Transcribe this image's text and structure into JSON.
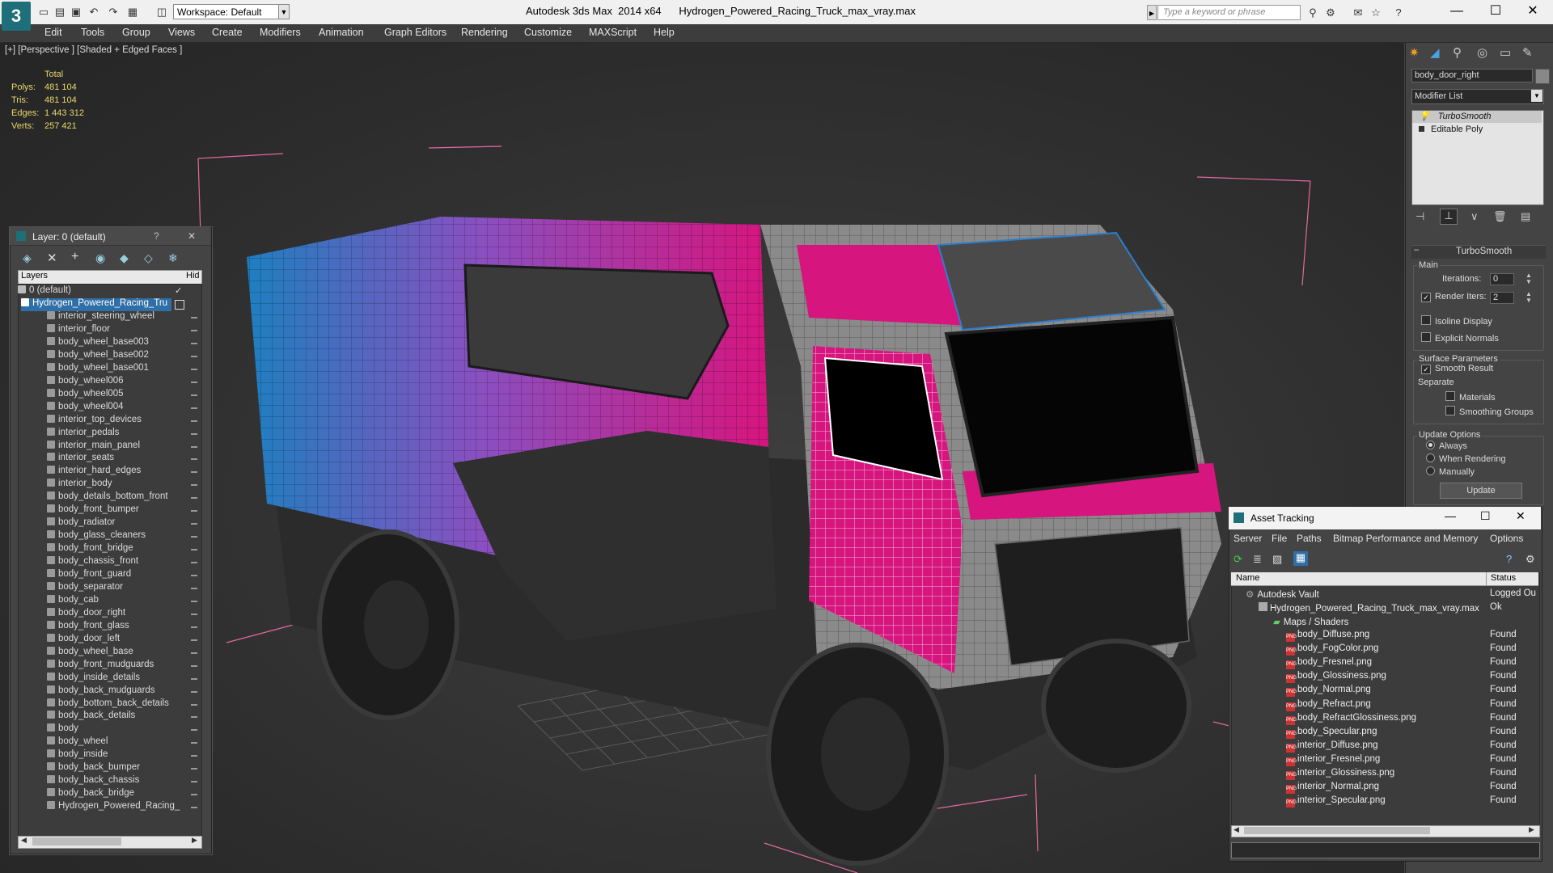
{
  "title_bar": {
    "app_title": "Autodesk 3ds Max  2014 x64",
    "file_title": "Hydrogen_Powered_Racing_Truck_max_vray.max",
    "workspace_label": "Workspace: Default",
    "search_placeholder": "Type a keyword or phrase",
    "logo_glyph": "3"
  },
  "menu": [
    "Edit",
    "Tools",
    "Group",
    "Views",
    "Create",
    "Modifiers",
    "Animation",
    "Graph Editors",
    "Rendering",
    "Customize",
    "MAXScript",
    "Help"
  ],
  "viewport": {
    "label": "[+] [Perspective ] [Shaded + Edged Faces ]",
    "stats": {
      "header": "Total",
      "rows": [
        {
          "label": "Polys:",
          "value": "481 104"
        },
        {
          "label": "Tris:",
          "value": "481 104"
        },
        {
          "label": "Edges:",
          "value": "1 443 312"
        },
        {
          "label": "Verts:",
          "value": "257 421"
        }
      ]
    }
  },
  "layer_panel": {
    "title": "Layer: 0 (default)",
    "help": "?",
    "close": "✕",
    "col_layers": "Layers",
    "col_hide": "Hid",
    "default_layer": "0 (default)",
    "selected_layer": "Hydrogen_Powered_Racing_Tru",
    "items": [
      "interior_steering_wheel",
      "interior_floor",
      "body_wheel_base003",
      "body_wheel_base002",
      "body_wheel_base001",
      "body_wheel006",
      "body_wheel005",
      "body_wheel004",
      "interior_top_devices",
      "interior_pedals",
      "interior_main_panel",
      "interior_seats",
      "interior_hard_edges",
      "interior_body",
      "body_details_bottom_front",
      "body_front_bumper",
      "body_radiator",
      "body_glass_cleaners",
      "body_front_bridge",
      "body_chassis_front",
      "body_front_guard",
      "body_separator",
      "body_cab",
      "body_door_right",
      "body_front_glass",
      "body_door_left",
      "body_wheel_base",
      "body_front_mudguards",
      "body_inside_details",
      "body_back_mudguards",
      "body_bottom_back_details",
      "body_back_details",
      "body",
      "body_wheel",
      "body_inside",
      "body_back_bumper",
      "body_back_chassis",
      "body_back_bridge",
      "Hydrogen_Powered_Racing_"
    ]
  },
  "command_panel": {
    "object_name": "body_door_right",
    "modifier_list": "Modifier List",
    "stack": [
      "TurboSmooth",
      "Editable Poly"
    ],
    "rollout_title": "TurboSmooth",
    "main_label": "Main",
    "iterations_label": "Iterations:",
    "iterations_value": "0",
    "render_iters_label": "Render Iters:",
    "render_iters_value": "2",
    "isoline": "Isoline Display",
    "explicit": "Explicit Normals",
    "surface_label": "Surface Parameters",
    "smooth_result": "Smooth Result",
    "separate_label": "Separate",
    "materials": "Materials",
    "smoothing_groups": "Smoothing Groups",
    "update_label": "Update Options",
    "always": "Always",
    "when_rendering": "When Rendering",
    "manually": "Manually",
    "update_button": "Update"
  },
  "asset_tracking": {
    "title": "Asset Tracking",
    "menu": [
      "Server",
      "File",
      "Paths",
      "Bitmap Performance and Memory",
      "Options"
    ],
    "col_name": "Name",
    "col_status": "Status",
    "vault": {
      "name": "Autodesk Vault",
      "status": "Logged Ou"
    },
    "file": {
      "name": "Hydrogen_Powered_Racing_Truck_max_vray.max",
      "status": "Ok"
    },
    "folder": "Maps / Shaders",
    "maps": [
      {
        "name": "body_Diffuse.png",
        "status": "Found"
      },
      {
        "name": "body_FogColor.png",
        "status": "Found"
      },
      {
        "name": "body_Fresnel.png",
        "status": "Found"
      },
      {
        "name": "body_Glossiness.png",
        "status": "Found"
      },
      {
        "name": "body_Normal.png",
        "status": "Found"
      },
      {
        "name": "body_Refract.png",
        "status": "Found"
      },
      {
        "name": "body_RefractGlossiness.png",
        "status": "Found"
      },
      {
        "name": "body_Specular.png",
        "status": "Found"
      },
      {
        "name": "interior_Diffuse.png",
        "status": "Found"
      },
      {
        "name": "interior_Fresnel.png",
        "status": "Found"
      },
      {
        "name": "interior_Glossiness.png",
        "status": "Found"
      },
      {
        "name": "interior_Normal.png",
        "status": "Found"
      },
      {
        "name": "interior_Specular.png",
        "status": "Found"
      }
    ]
  },
  "colors": {
    "accent": "#2f6fa8",
    "stats": "#e8d86b",
    "truck_pink": "#d6157e",
    "truck_blue": "#1e7fc0"
  }
}
